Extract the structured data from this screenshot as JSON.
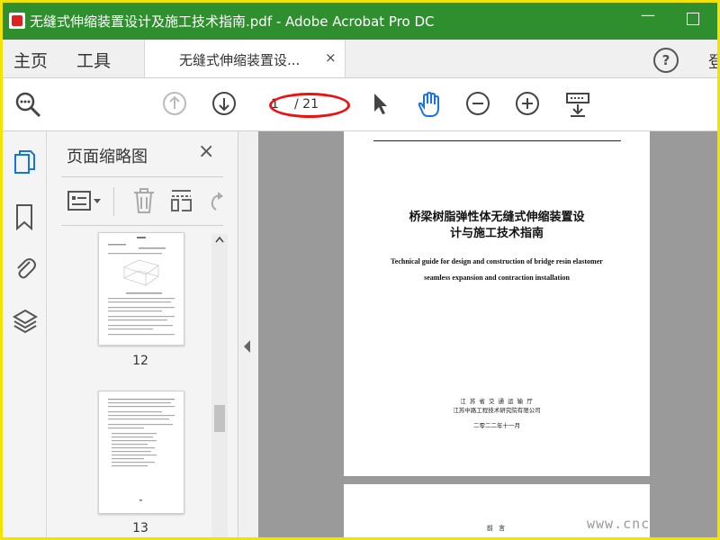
{
  "window": {
    "title": "无缝式伸缩装置设计及施工技术指南.pdf - Adobe Acrobat Pro DC",
    "minimize": "—"
  },
  "tabs": {
    "home": "主页",
    "tools": "工具",
    "document": "无缝式伸缩装置设...",
    "close": "×",
    "help": "?",
    "signin_partial": "登"
  },
  "toolbar": {
    "page_current": "1",
    "page_total": "/ 21"
  },
  "thumbnails_panel": {
    "title": "页面缩略图",
    "close": "×",
    "pages": [
      {
        "label": "12"
      },
      {
        "label": "13"
      }
    ]
  },
  "document": {
    "cn_title_line1": "桥梁树脂弹性体无缝式伸缩装置设",
    "cn_title_line2": "计与施工技术指南",
    "en_title_line1": "Technical guide for design and construction of bridge resin elastomer",
    "en_title_line2": "seamless expansion and contraction installation",
    "org_line1": "江 苏 省 交 通 运 输 厅",
    "org_line2": "江苏中路工程技术研究院有限公司",
    "date_line": "二零二二年十一月",
    "page2_heading": "前 言"
  },
  "watermark": "www.cnc",
  "colors": {
    "titlebar": "#2f8f2f",
    "frame_border": "#f2e400",
    "accent_blue": "#1473e6",
    "highlight_red": "#e11111"
  }
}
